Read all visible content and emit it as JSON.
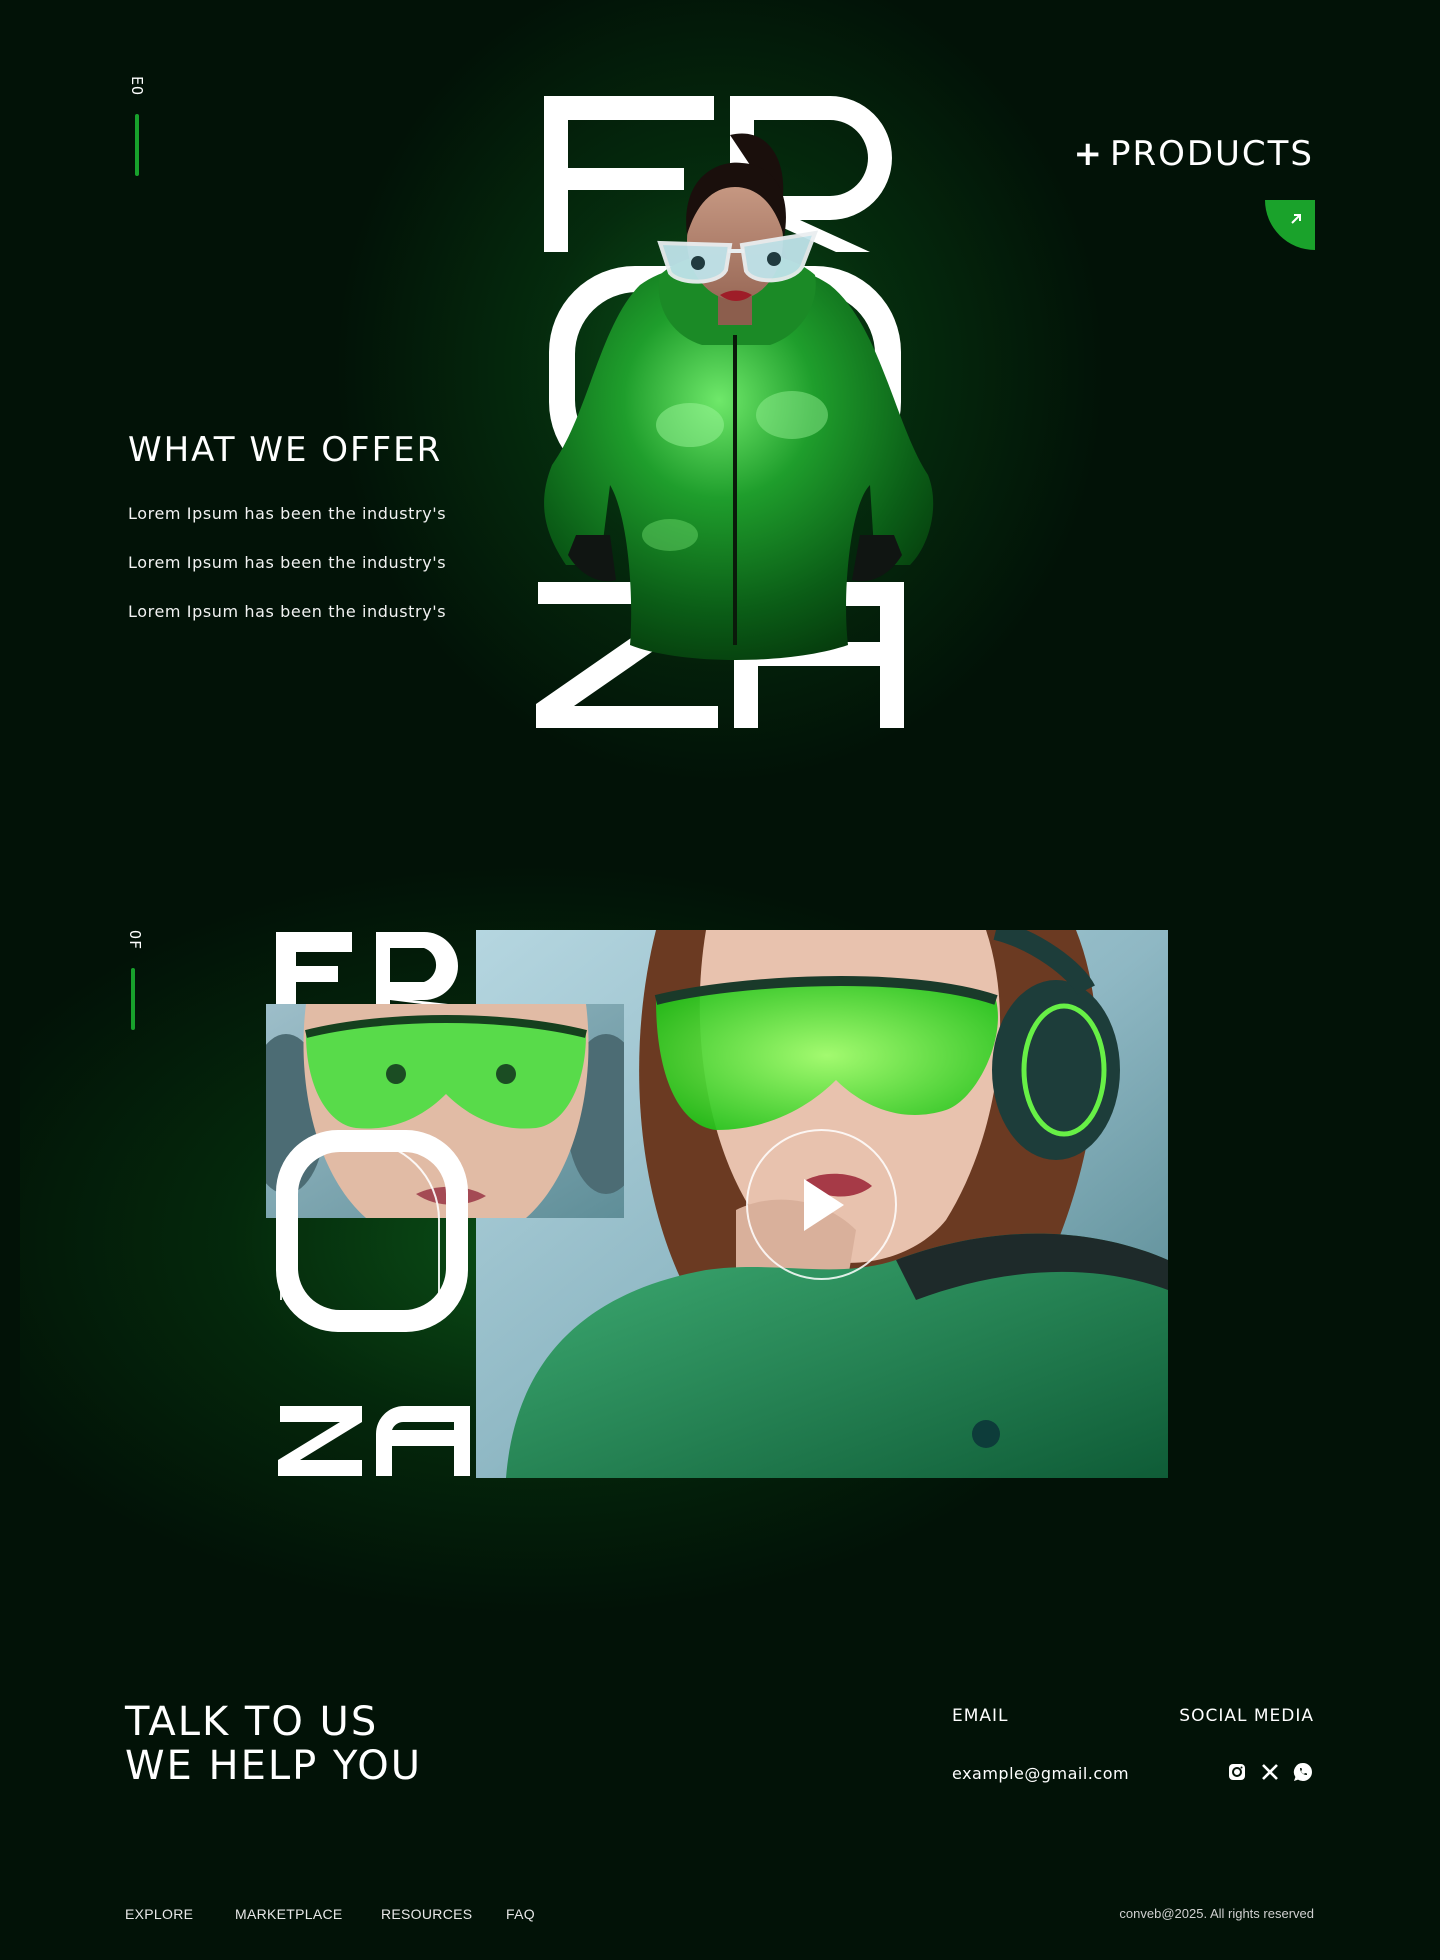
{
  "section1": {
    "side_label": "EO",
    "brand_letters": {
      "row1": "FR",
      "row2": "O",
      "row3": "ZA"
    },
    "offer": {
      "title": "WHAT WE OFFER",
      "items": [
        "Lorem Ipsum has been the industry's",
        "Lorem Ipsum has been the industry's",
        "Lorem Ipsum has been the industry's"
      ]
    },
    "products": {
      "plus": "+",
      "label": "PRODUCTS"
    }
  },
  "section2": {
    "side_label": "OF",
    "brand_letters": {
      "row1": "FR",
      "row2": "O",
      "row3": "ZA"
    }
  },
  "footer": {
    "talk_line1": "TALK TO US",
    "talk_line2": "WE HELP YOU",
    "email_heading": "EMAIL",
    "email_value": "example@gmail.com",
    "social_heading": "SOCIAL MEDIA",
    "social_icons": [
      "instagram-icon",
      "x-icon",
      "whatsapp-icon"
    ],
    "nav": [
      "EXPLORE",
      "MARKETPLACE",
      "RESOURCES",
      "FAQ"
    ],
    "copyright": "conveb@2025. All rights reserved"
  },
  "colors": {
    "background": "#021207",
    "accent": "#1aa22b",
    "text": "#ffffff"
  }
}
